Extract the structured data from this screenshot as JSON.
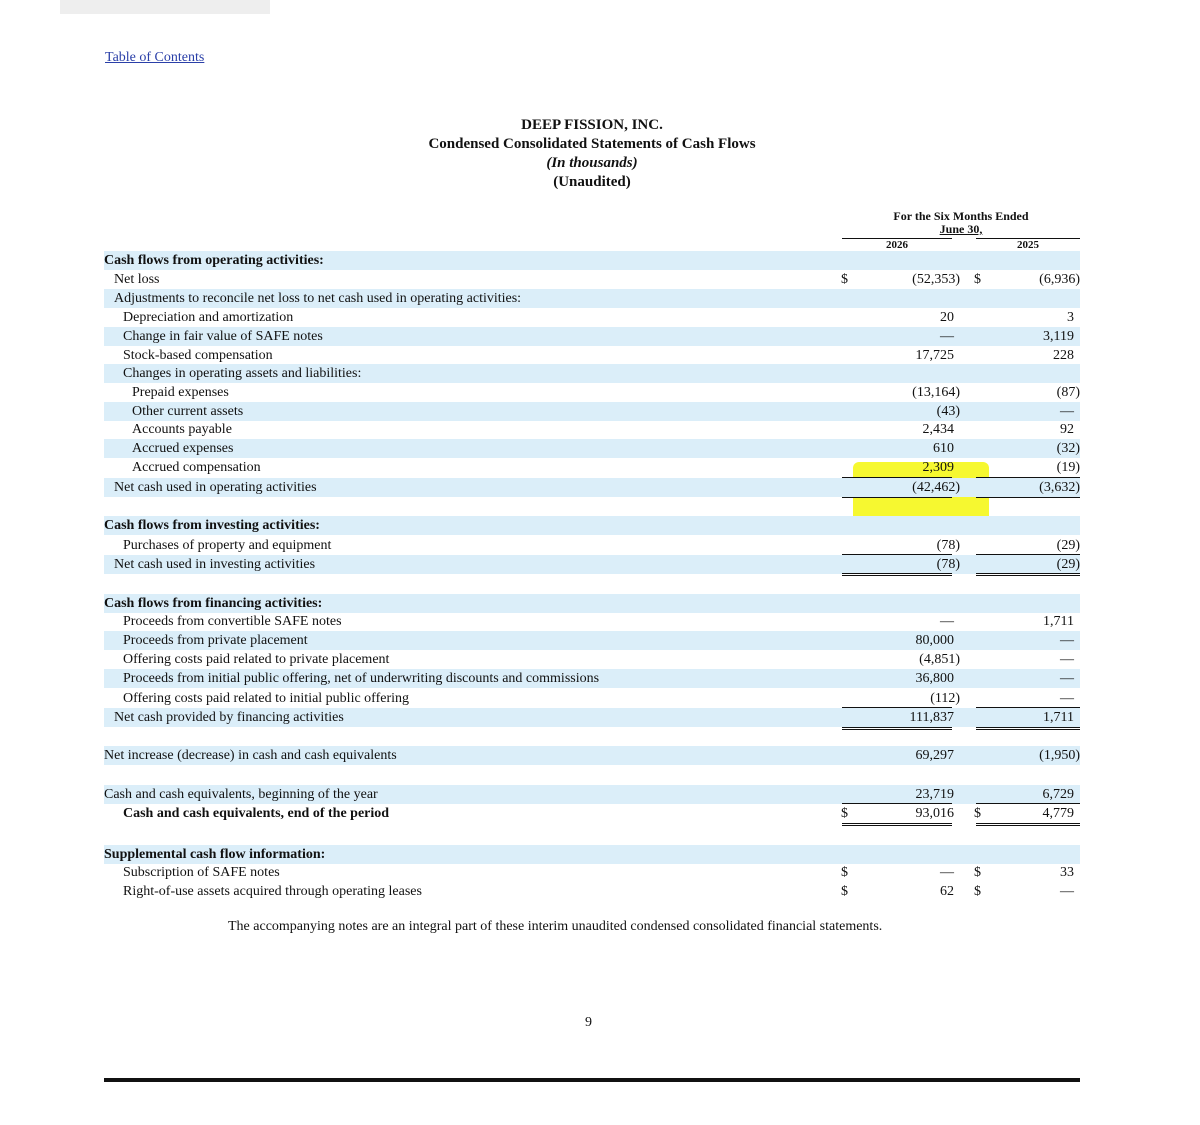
{
  "toc_link": "Table of Contents",
  "header": {
    "company": "DEEP FISSION, INC.",
    "statement": "Condensed Consolidated Statements of Cash Flows",
    "units": "(In thousands)",
    "audit": "(Unaudited)"
  },
  "columns": {
    "period_line1": "For the Six Months Ended",
    "period_line2": "June 30,",
    "year1": "2026",
    "year2": "2025"
  },
  "rows": [
    {
      "label": "Cash flows from operating activities:",
      "bold": true,
      "indent": 0,
      "shade": true,
      "v1": "",
      "v2": ""
    },
    {
      "label": "Net loss",
      "indent": 1,
      "shade": false,
      "cur1": "$",
      "v1": "(52,353)",
      "cur2": "$",
      "v2": "(6,936)"
    },
    {
      "label": "Adjustments to reconcile net loss to net cash used in operating activities:",
      "indent": 1,
      "shade": true,
      "v1": "",
      "v2": ""
    },
    {
      "label": "Depreciation and amortization",
      "indent": 2,
      "shade": false,
      "v1": "20",
      "v2": "3"
    },
    {
      "label": "Change in fair value of SAFE notes",
      "indent": 2,
      "shade": true,
      "v1": "—",
      "v2": "3,119"
    },
    {
      "label": "Stock-based compensation",
      "indent": 2,
      "shade": false,
      "v1": "17,725",
      "v2": "228"
    },
    {
      "label": "Changes in operating assets and liabilities:",
      "indent": 2,
      "shade": true,
      "v1": "",
      "v2": ""
    },
    {
      "label": "Prepaid expenses",
      "indent": 3,
      "shade": false,
      "v1": "(13,164)",
      "v2": "(87)"
    },
    {
      "label": "Other current assets",
      "indent": 3,
      "shade": true,
      "v1": "(43)",
      "v2": "—"
    },
    {
      "label": "Accounts payable",
      "indent": 3,
      "shade": false,
      "v1": "2,434",
      "v2": "92"
    },
    {
      "label": "Accrued expenses",
      "indent": 3,
      "shade": true,
      "v1": "610",
      "v2": "(32)"
    },
    {
      "label": "Accrued compensation",
      "indent": 3,
      "shade": false,
      "v1": "2,309",
      "v2": "(19)"
    },
    {
      "label": "Net cash used in operating activities",
      "indent": 1,
      "shade": true,
      "v1": "(42,462)",
      "v2": "(3,632)"
    },
    {
      "label": "Cash flows from investing activities:",
      "bold": true,
      "indent": 0,
      "shade": true,
      "v1": "",
      "v2": ""
    },
    {
      "label": "Purchases of property and equipment",
      "indent": 2,
      "shade": false,
      "v1": "(78)",
      "v2": "(29)"
    },
    {
      "label": "Net cash used in investing activities",
      "indent": 1,
      "shade": true,
      "v1": "(78)",
      "v2": "(29)"
    },
    {
      "label": "Cash flows from financing activities:",
      "bold": true,
      "indent": 0,
      "shade": true,
      "v1": "",
      "v2": ""
    },
    {
      "label": "Proceeds from convertible SAFE notes",
      "indent": 2,
      "shade": false,
      "v1": "—",
      "v2": "1,711"
    },
    {
      "label": "Proceeds from private placement",
      "indent": 2,
      "shade": true,
      "v1": "80,000",
      "v2": "—"
    },
    {
      "label": "Offering costs paid related to private placement",
      "indent": 2,
      "shade": false,
      "v1": "(4,851)",
      "v2": "—"
    },
    {
      "label": "Proceeds from initial public offering, net of underwriting discounts and commissions",
      "indent": 2,
      "shade": true,
      "v1": "36,800",
      "v2": "—"
    },
    {
      "label": "Offering costs paid related to initial public offering",
      "indent": 2,
      "shade": false,
      "v1": "(112)",
      "v2": "—"
    },
    {
      "label": "Net cash provided by financing activities",
      "indent": 1,
      "shade": true,
      "v1": "111,837",
      "v2": "1,711"
    },
    {
      "label": "Net increase (decrease) in cash and cash equivalents",
      "indent": 0,
      "shade": true,
      "v1": "69,297",
      "v2": "(1,950)"
    },
    {
      "label": "Cash and cash equivalents, beginning of the year",
      "indent": 0,
      "shade": true,
      "v1": "23,719",
      "v2": "6,729"
    },
    {
      "label": "Cash and cash equivalents, end of the period",
      "bold": true,
      "indent": 2,
      "shade": false,
      "cur1": "$",
      "v1": "93,016",
      "cur2": "$",
      "v2": "4,779"
    },
    {
      "label": "Supplemental cash flow information:",
      "bold": true,
      "indent": 0,
      "shade": true,
      "v1": "",
      "v2": ""
    },
    {
      "label": "Subscription of SAFE notes",
      "indent": 2,
      "shade": false,
      "cur1": "$",
      "v1": "—",
      "cur2": "$",
      "v2": "33"
    },
    {
      "label": "Right-of-use assets acquired through operating leases",
      "indent": 2,
      "shade": false,
      "cur1": "$",
      "v1": "62",
      "cur2": "$",
      "v2": "—"
    }
  ],
  "footnote": "The accompanying notes are an integral part of these interim unaudited condensed consolidated financial statements.",
  "page_number": "9",
  "colors": {
    "row_shade": "#dbeef9",
    "highlight": "#f4f70c",
    "link": "#2a3fa8"
  }
}
